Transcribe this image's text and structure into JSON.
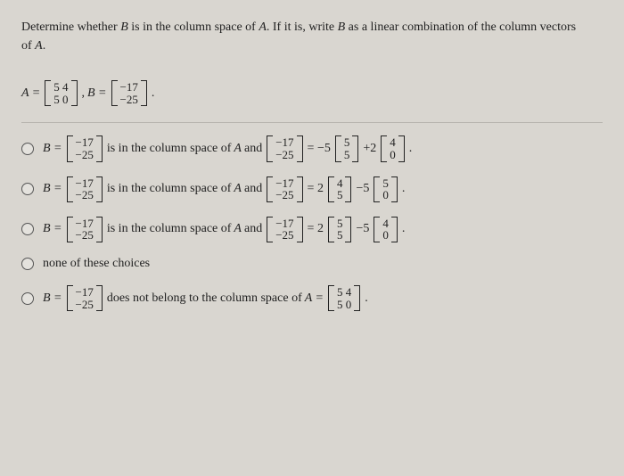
{
  "prompt": {
    "line1_a": "Determine whether ",
    "line1_b": " is in the column space of ",
    "line1_c": ". If it is, write ",
    "line1_d": " as a linear combination of the column vectors",
    "line2": "of ",
    "B": "B",
    "A": "A"
  },
  "given": {
    "A_eq": "A =",
    "A_rows": [
      "5 4",
      "5 0"
    ],
    "comma": ", ",
    "B_eq": "B =",
    "B_rows": [
      "−17",
      "−25"
    ],
    "period": "."
  },
  "choice1": {
    "B_eq": "B =",
    "B_rows": [
      "−17",
      "−25"
    ],
    "text1": " is in the column space of ",
    "A": "A",
    "text2": " and ",
    "lhs_rows": [
      "−17",
      "−25"
    ],
    "eq": " = −5",
    "v1_rows": [
      "5",
      "5"
    ],
    "plus": "+2",
    "v2_rows": [
      "4",
      "0"
    ],
    "period": "."
  },
  "choice2": {
    "B_eq": "B =",
    "B_rows": [
      "−17",
      "−25"
    ],
    "text1": " is in the column space of ",
    "A": "A",
    "text2": " and ",
    "lhs_rows": [
      "−17",
      "−25"
    ],
    "eq": " = 2",
    "v1_rows": [
      "4",
      "5"
    ],
    "minus": "−5",
    "v2_rows": [
      "5",
      "0"
    ],
    "period": "."
  },
  "choice3": {
    "B_eq": "B =",
    "B_rows": [
      "−17",
      "−25"
    ],
    "text1": " is in the column space of ",
    "A": "A",
    "text2": " and ",
    "lhs_rows": [
      "−17",
      "−25"
    ],
    "eq": " = 2",
    "v1_rows": [
      "5",
      "5"
    ],
    "minus": "−5",
    "v2_rows": [
      "4",
      "0"
    ],
    "period": "."
  },
  "choice4": {
    "text": "none of these choices"
  },
  "choice5": {
    "B_eq": "B =",
    "B_rows": [
      "−17",
      "−25"
    ],
    "text1": " does not belong to the column space of ",
    "A_eq": "A =",
    "A_rows": [
      "5 4",
      "5 0"
    ],
    "period": "."
  }
}
